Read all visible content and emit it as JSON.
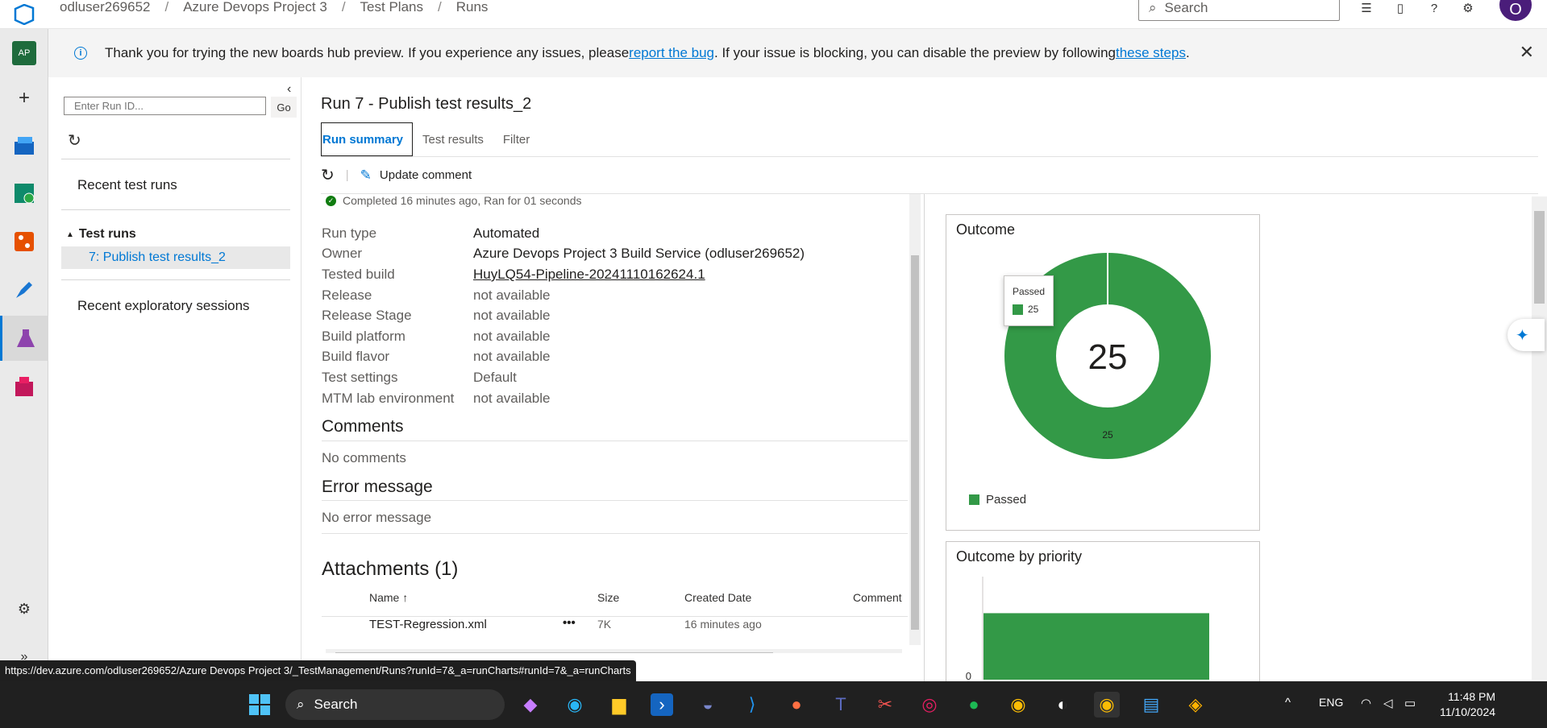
{
  "header": {
    "breadcrumb": [
      "odluser269652",
      "Azure Devops Project 3",
      "Test Plans",
      "Runs"
    ],
    "search_placeholder": "Search",
    "avatar_letter": "O"
  },
  "leftnav": {
    "project_badge": "AP"
  },
  "banner": {
    "text_before": "Thank you for trying the new boards hub preview. If you experience any issues, please ",
    "link1": "report the bug",
    "text_middle": ". If your issue is blocking, you can disable the preview by following ",
    "link2": "these steps",
    "text_after": "."
  },
  "runs_panel": {
    "run_id_placeholder": "Enter Run ID...",
    "go_label": "Go",
    "recent_test_runs": "Recent test runs",
    "test_runs_header": "Test runs",
    "selected_run": "7: Publish test results_2",
    "recent_exploratory": "Recent exploratory sessions"
  },
  "main": {
    "title": "Run 7 - Publish test results_2",
    "tabs": [
      {
        "label": "Run summary",
        "active": true
      },
      {
        "label": "Test results",
        "active": false
      },
      {
        "label": "Filter",
        "active": false
      }
    ],
    "update_comment": "Update comment",
    "status": "Completed 16 minutes ago, Ran for 01 seconds",
    "properties": [
      {
        "key": "Run type",
        "value": "Automated",
        "style": "dark"
      },
      {
        "key": "Owner",
        "value": "Azure Devops Project 3 Build Service (odluser269652)",
        "style": "dark"
      },
      {
        "key": "Tested build",
        "value": "HuyLQ54-Pipeline-20241110162624.1",
        "style": "link"
      },
      {
        "key": "Release",
        "value": "not available",
        "style": "muted"
      },
      {
        "key": "Release Stage",
        "value": "not available",
        "style": "muted"
      },
      {
        "key": "Build platform",
        "value": "not available",
        "style": "muted"
      },
      {
        "key": "Build flavor",
        "value": "not available",
        "style": "muted"
      },
      {
        "key": "Test settings",
        "value": "Default",
        "style": "muted"
      },
      {
        "key": "MTM lab environment",
        "value": "not available",
        "style": "muted"
      }
    ],
    "comments_title": "Comments",
    "comments_text": "No comments",
    "error_title": "Error message",
    "error_text": "No error message",
    "attachments_title": "Attachments (1)",
    "attachment_columns": {
      "name": "Name",
      "size": "Size",
      "created": "Created Date",
      "comment": "Comment"
    },
    "attachments": [
      {
        "name": "TEST-Regression.xml",
        "size": "7K",
        "created": "16 minutes ago",
        "comment": ""
      }
    ]
  },
  "chart_data": [
    {
      "type": "pie",
      "title": "Outcome",
      "center_label": "25",
      "slices": [
        {
          "name": "Passed",
          "value": 25,
          "color": "#339947"
        }
      ],
      "tooltip": {
        "name": "Passed",
        "value": "25"
      },
      "legend": [
        "Passed"
      ]
    },
    {
      "type": "bar",
      "title": "Outcome by priority",
      "categories": [
        "0"
      ],
      "series": [
        {
          "name": "Passed",
          "values": [
            25
          ],
          "color": "#339947"
        }
      ]
    }
  ],
  "status_bar_url": "https://dev.azure.com/odluser269652/Azure Devops Project 3/_TestManagement/Runs?runId=7&_a=runCharts#runId=7&_a=runCharts",
  "taskbar": {
    "search_label": "Search",
    "language": "ENG",
    "time": "11:48 PM",
    "date": "11/10/2024"
  }
}
